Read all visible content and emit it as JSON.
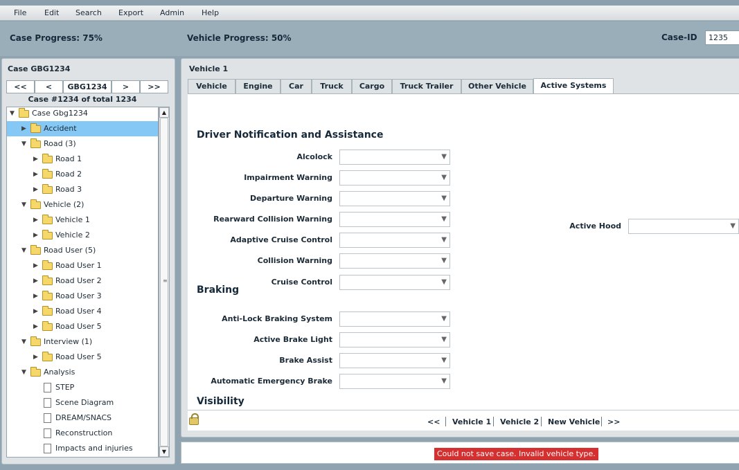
{
  "menu": [
    "File",
    "Edit",
    "Search",
    "Export",
    "Admin",
    "Help"
  ],
  "progress": {
    "case": "Case Progress: 75%",
    "vehicle": "Vehicle Progress: 50%",
    "case_id_label": "Case-ID",
    "case_id_value": "1235"
  },
  "left": {
    "title": "Case GBG1234",
    "nav": {
      "first": "<<",
      "prev": "<",
      "current": "GBG1234",
      "next": ">",
      "last": ">>"
    },
    "count": "Case #1234 of total 1234",
    "tree": [
      {
        "label": "Case Gbg1234",
        "level": 0,
        "type": "folder",
        "open": true
      },
      {
        "label": "Accident",
        "level": 1,
        "type": "folder",
        "open": false,
        "selected": true
      },
      {
        "label": "Road (3)",
        "level": 1,
        "type": "folder",
        "open": true
      },
      {
        "label": "Road 1",
        "level": 2,
        "type": "folder",
        "open": false
      },
      {
        "label": "Road 2",
        "level": 2,
        "type": "folder",
        "open": false
      },
      {
        "label": "Road 3",
        "level": 2,
        "type": "folder",
        "open": false
      },
      {
        "label": "Vehicle (2)",
        "level": 1,
        "type": "folder",
        "open": true
      },
      {
        "label": "Vehicle 1",
        "level": 2,
        "type": "folder",
        "open": false
      },
      {
        "label": "Vehicle 2",
        "level": 2,
        "type": "folder",
        "open": false
      },
      {
        "label": "Road User (5)",
        "level": 1,
        "type": "folder",
        "open": true
      },
      {
        "label": "Road User 1",
        "level": 2,
        "type": "folder",
        "open": false
      },
      {
        "label": "Road User 2",
        "level": 2,
        "type": "folder",
        "open": false
      },
      {
        "label": "Road User 3",
        "level": 2,
        "type": "folder",
        "open": false
      },
      {
        "label": "Road User 4",
        "level": 2,
        "type": "folder",
        "open": false
      },
      {
        "label": "Road User 5",
        "level": 2,
        "type": "folder",
        "open": false
      },
      {
        "label": "Interview (1)",
        "level": 1,
        "type": "folder",
        "open": true
      },
      {
        "label": "Road User 5",
        "level": 2,
        "type": "folder",
        "open": false
      },
      {
        "label": "Analysis",
        "level": 1,
        "type": "folder",
        "open": true
      },
      {
        "label": "STEP",
        "level": 2,
        "type": "doc"
      },
      {
        "label": "Scene Diagram",
        "level": 2,
        "type": "doc"
      },
      {
        "label": "DREAM/SNACS",
        "level": 2,
        "type": "doc"
      },
      {
        "label": "Reconstruction",
        "level": 2,
        "type": "doc"
      },
      {
        "label": "Impacts and injuries",
        "level": 2,
        "type": "doc"
      }
    ]
  },
  "right": {
    "title": "Vehicle 1",
    "tabs": [
      "Vehicle",
      "Engine",
      "Car",
      "Truck",
      "Cargo",
      "Truck Trailer",
      "Other Vehicle",
      "Active Systems"
    ],
    "active_tab": "Active Systems",
    "sections": {
      "driver": "Driver Notification and Assistance",
      "braking": "Braking",
      "visibility": "Visibility"
    },
    "fields": {
      "alcolock": "Alcolock",
      "impairment": "Impairment Warning",
      "departure": "Departure Warning",
      "rearward": "Rearward Collision Warning",
      "adaptive": "Adaptive Cruise Control",
      "collision": "Collision Warning",
      "cruise": "Cruise Control",
      "abs": "Anti-Lock Braking System",
      "brake_light": "Active Brake Light",
      "brake_assist": "Brake Assist",
      "aeb": "Automatic Emergency Brake",
      "hood": "Active Hood"
    },
    "footer": {
      "first": "<<",
      "v1": "Vehicle 1",
      "v2": "Vehicle 2",
      "new": "New Vehicle",
      "last": ">>"
    }
  },
  "status": {
    "error": "Could not save case. Invalid vehicle type."
  }
}
